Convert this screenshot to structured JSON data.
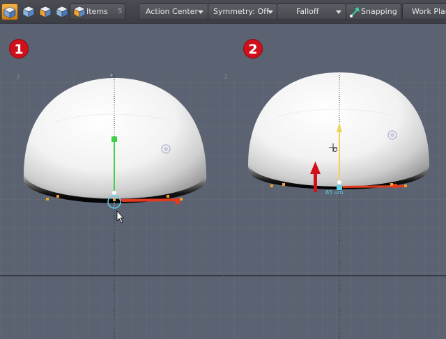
{
  "toolbar": {
    "items_label": "Items",
    "items_shortcut": "5",
    "action_center": "Action Center",
    "symmetry": "Symmetry: Off",
    "falloff": "Falloff",
    "snapping": "Snapping",
    "work_plane": "Work Plane"
  },
  "steps": {
    "step1": "1",
    "step2": "2"
  },
  "viewport": {
    "measure_label": "65 um"
  },
  "colors": {
    "accent_orange": "#f0a030",
    "marker_red": "#d0101a",
    "handle_green": "#3fd24a",
    "handle_yellow": "#f3d05a",
    "handle_cyan": "#5fd1e6",
    "grid_bg": "#5b6372"
  },
  "icons": {
    "select_mode": "cube-select-icon",
    "vertex_mode": "cube-vertex-icon",
    "edge_mode": "cube-edge-icon",
    "polygon_mode": "cube-polygon-icon",
    "items_mode": "cube-items-icon",
    "snapping": "snapping-icon"
  }
}
